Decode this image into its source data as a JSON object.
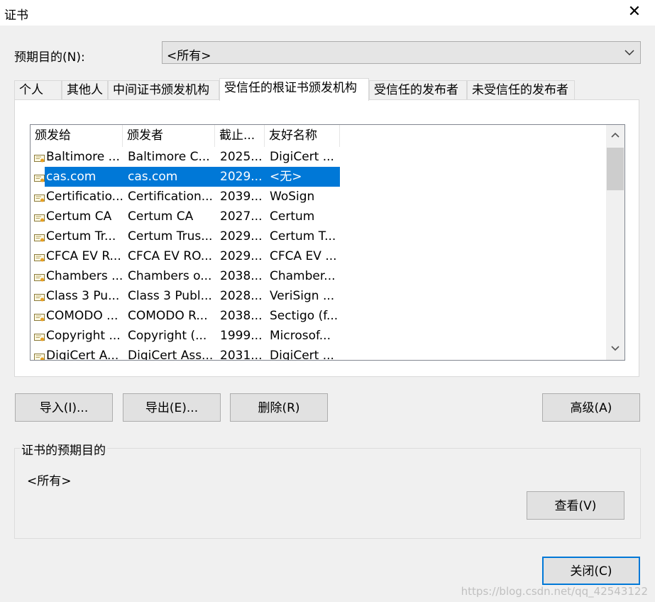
{
  "window": {
    "title": "证书"
  },
  "purpose": {
    "label": "预期目的(N):",
    "value": "<所有>"
  },
  "tabs": [
    {
      "label": "个人",
      "active": false
    },
    {
      "label": "其他人",
      "active": false
    },
    {
      "label": "中间证书颁发机构",
      "active": false
    },
    {
      "label": "受信任的根证书颁发机构",
      "active": true
    },
    {
      "label": "受信任的发布者",
      "active": false
    },
    {
      "label": "未受信任的发布者",
      "active": false
    }
  ],
  "list": {
    "columns": [
      "颁发给",
      "颁发者",
      "截止...",
      "友好名称"
    ],
    "rows": [
      [
        "Baltimore ...",
        "Baltimore C...",
        "2025...",
        "DigiCert ..."
      ],
      [
        "cas.com",
        "cas.com",
        "2029...",
        "<无>"
      ],
      [
        "Certificatio...",
        "Certification...",
        "2039...",
        "WoSign"
      ],
      [
        "Certum CA",
        "Certum CA",
        "2027...",
        "Certum"
      ],
      [
        "Certum Tr...",
        "Certum Trus...",
        "2029...",
        "Certum T..."
      ],
      [
        "CFCA EV R...",
        "CFCA EV RO...",
        "2029...",
        "CFCA EV ..."
      ],
      [
        "Chambers ...",
        "Chambers o...",
        "2038...",
        "Chamber..."
      ],
      [
        "Class 3 Pu...",
        "Class 3 Publ...",
        "2028...",
        "VeriSign ..."
      ],
      [
        "COMODO ...",
        "COMODO R...",
        "2038...",
        "Sectigo (f..."
      ],
      [
        "Copyright ...",
        "Copyright (...",
        "1999...",
        "Microsof..."
      ],
      [
        "DigiCert A...",
        "DigiCert Ass...",
        "2031...",
        "DigiCert ..."
      ]
    ],
    "selected_row": 1
  },
  "buttons": {
    "import": "导入(I)...",
    "export": "导出(E)...",
    "delete": "删除(R)",
    "advanced": "高级(A)",
    "view": "查看(V)",
    "close": "关闭(C)"
  },
  "purposes_group": {
    "title": "证书的预期目的",
    "value": "<所有>"
  },
  "watermark": "https://blog.csdn.net/qq_42543122",
  "colors": {
    "selection": "#0078d7",
    "window_bg": "#f0f0f0"
  }
}
